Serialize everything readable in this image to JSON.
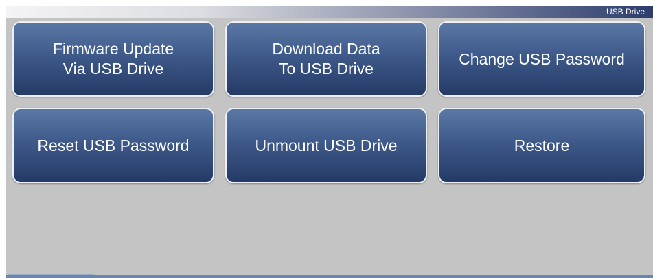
{
  "header": {
    "title": "USB Drive"
  },
  "buttons": [
    {
      "label": "Firmware Update\nVia USB Drive"
    },
    {
      "label": "Download Data\nTo USB Drive"
    },
    {
      "label": "Change USB Password"
    },
    {
      "label": "Reset USB Password"
    },
    {
      "label": "Unmount USB Drive"
    },
    {
      "label": "Restore"
    }
  ],
  "colors": {
    "background": "#c4c4c4",
    "button_top": "#5a78a6",
    "button_bottom": "#243a66",
    "button_border": "#eef0f4",
    "header_gradient_end": "#2c3d6e"
  }
}
